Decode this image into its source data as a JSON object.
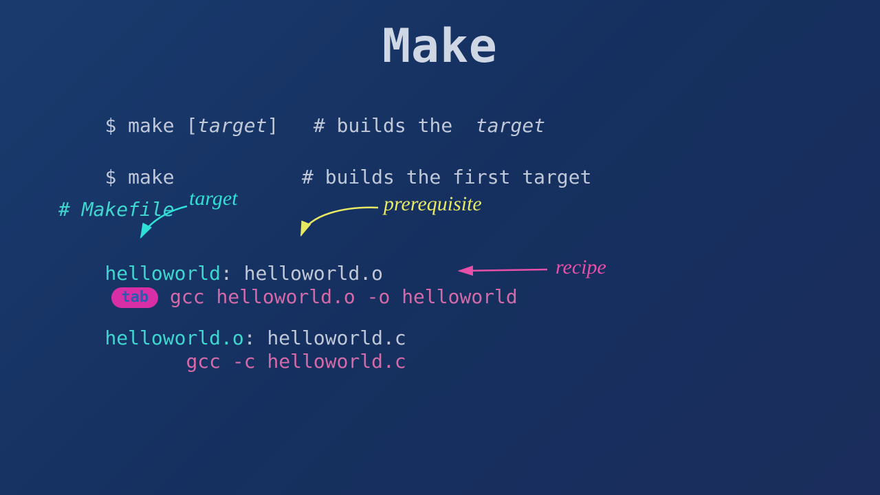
{
  "title": "Make",
  "line1": {
    "prefix": "$ make [",
    "arg": "target",
    "suffix": "]",
    "comment_prefix": "   # builds the  ",
    "comment_arg": "target"
  },
  "line2": {
    "cmd": "$ make",
    "spaces": "           ",
    "comment": "# builds the first target"
  },
  "makefile_comment": "# Makefile",
  "rule1": {
    "target": "helloworld",
    "sep": ": ",
    "prereq": "helloworld.o",
    "tab_label": "tab",
    "recipe": " gcc helloworld.o -o helloworld"
  },
  "rule2": {
    "target": "helloworld.o",
    "sep": ": ",
    "prereq": "helloworld.c",
    "indent": "       ",
    "recipe": "gcc -c helloworld.c"
  },
  "annotations": {
    "target": "target",
    "prerequisite": "prerequisite",
    "recipe": "recipe"
  }
}
